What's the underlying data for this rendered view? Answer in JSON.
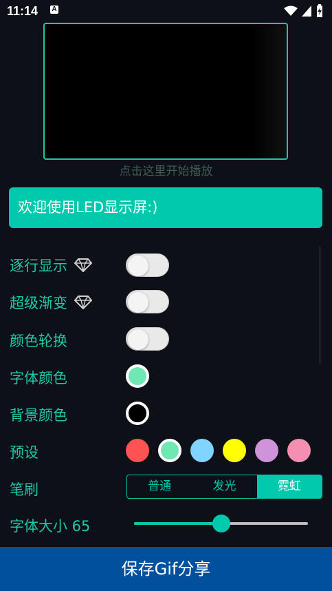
{
  "status_bar": {
    "time": "11:14",
    "notification_icon": "A",
    "icons": [
      "wifi-icon",
      "signal-icon",
      "battery-charging-icon"
    ]
  },
  "preview": {
    "hint": "点击这里开始播放"
  },
  "banner": {
    "text": "欢迎使用LED显示屏:)"
  },
  "settings": {
    "line_by_line": {
      "label": "逐行显示",
      "premium_icon": "diamond-icon",
      "on": false
    },
    "super_gradient": {
      "label": "超级渐变",
      "premium_icon": "diamond-icon",
      "on": false
    },
    "color_cycle": {
      "label": "颜色轮换",
      "on": false
    },
    "font_color": {
      "label": "字体颜色",
      "color": "#6fe8b4"
    },
    "bg_color": {
      "label": "背景颜色",
      "color": "#000000"
    },
    "presets": {
      "label": "预设",
      "colors": [
        "#ff5252",
        "#6fe8b4",
        "#80d4ff",
        "#ffff00",
        "#ce93d8",
        "#f48fb1"
      ],
      "selected_index": 1
    },
    "brush": {
      "label": "笔刷",
      "options": [
        "普通",
        "发光",
        "霓虹"
      ],
      "selected_index": 2
    },
    "font_size": {
      "label": "字体大小 65",
      "value": 65,
      "slider_fraction": 0.5
    }
  },
  "save_button": {
    "label": "保存Gif分享"
  },
  "colors": {
    "accent": "#00c9ae",
    "background": "#0d1117",
    "save_bar": "#00509e"
  }
}
